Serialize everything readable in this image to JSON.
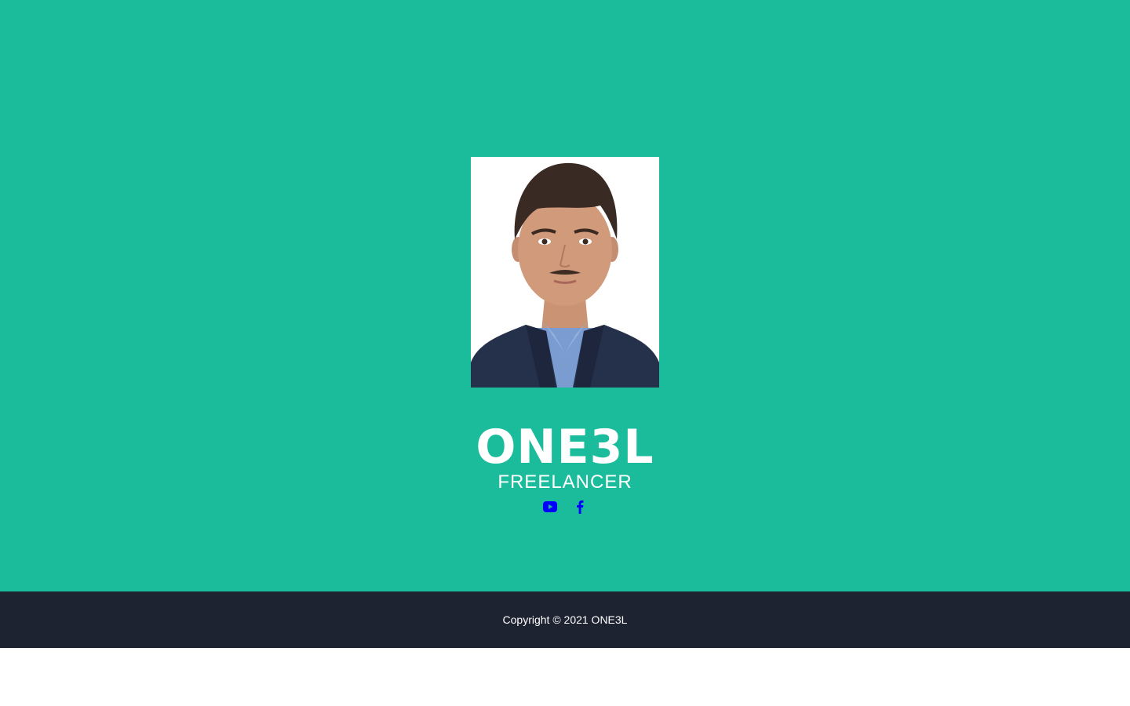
{
  "header": {
    "name": "ONE3L",
    "tagline": "FREELANCER"
  },
  "social": [
    {
      "icon": "youtube-icon",
      "color": "#0000ff"
    },
    {
      "icon": "facebook-icon",
      "color": "#0000ff"
    }
  ],
  "footer": {
    "copyright": "Copyright © 2021 ONE3L"
  },
  "colors": {
    "masthead": "#1abc9c",
    "footer": "#1e2331",
    "text": "#ffffff",
    "link": "#0000ff"
  }
}
